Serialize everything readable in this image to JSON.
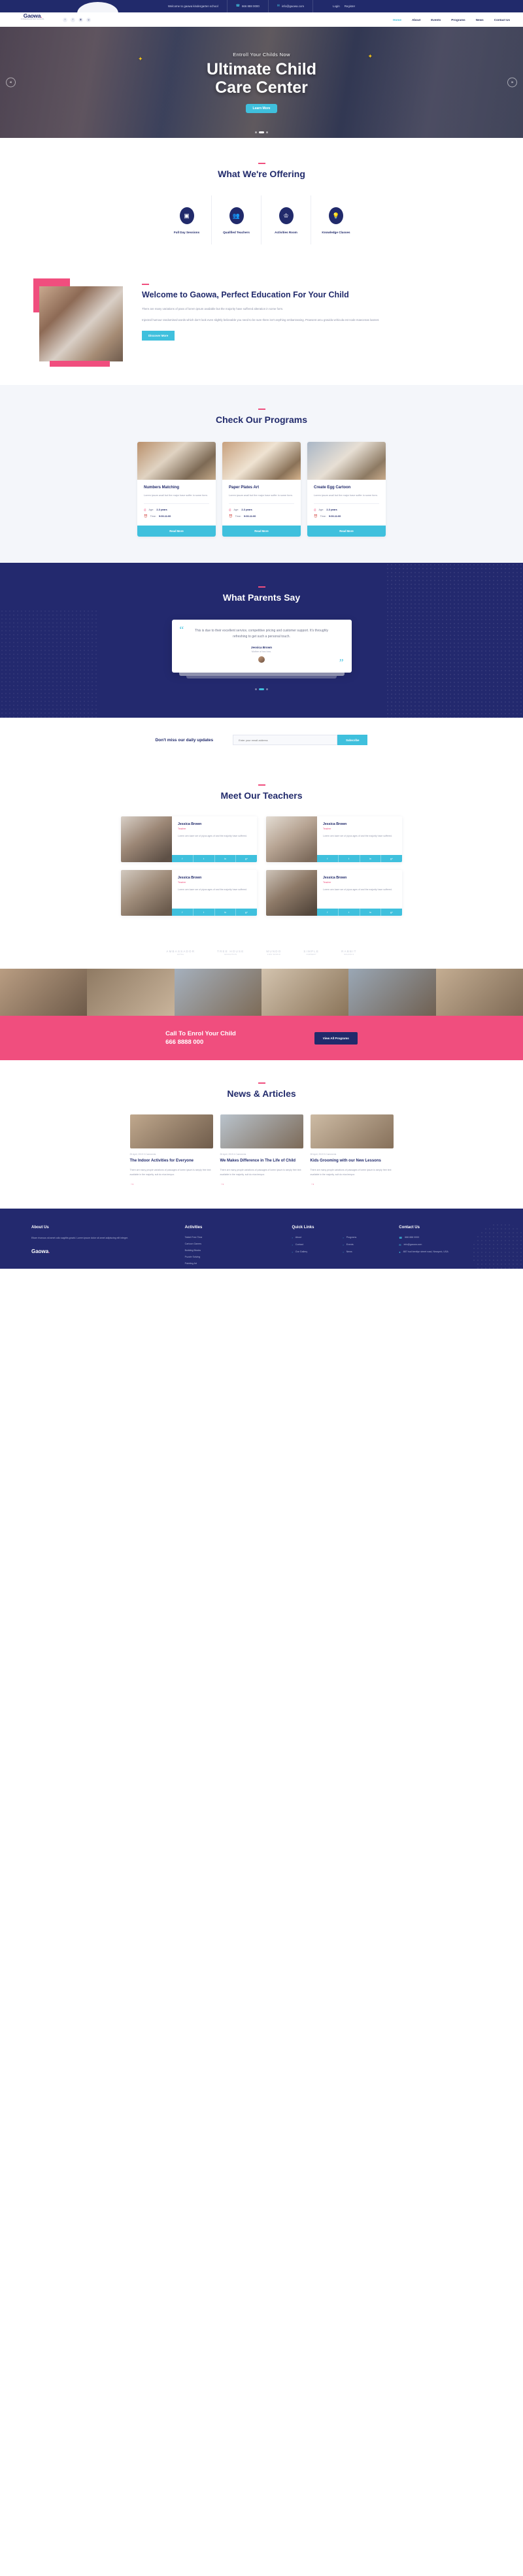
{
  "topbar": {
    "welcome": "Welcome to gaowa kindergarten school",
    "phone": "666 888 0000",
    "email": "info@gaowa.com",
    "login": "Login",
    "register": "Register",
    "phone_icon": "phone-icon",
    "mail_icon": "mail-icon"
  },
  "nav": {
    "logo": "Gaowa",
    "logo_sub": "KINDERGARTEN SCHOOL",
    "social": [
      "twitter-icon",
      "facebook-icon",
      "instagram-icon",
      "google-plus-icon"
    ],
    "menu": [
      {
        "label": "Home",
        "active": true
      },
      {
        "label": "About",
        "active": false
      },
      {
        "label": "Events",
        "active": false
      },
      {
        "label": "Programs",
        "active": false
      },
      {
        "label": "News",
        "active": false
      },
      {
        "label": "Contact Us",
        "active": false
      }
    ]
  },
  "hero": {
    "kicker": "Entroll Your Childs Now",
    "title_line1": "Ultimate Child",
    "title_line2": "Care Center",
    "button": "Learn More",
    "prev": "«",
    "next": "»"
  },
  "offering": {
    "title": "What We're Offering",
    "cards": [
      {
        "label": "Full Day Sessions",
        "icon": "abc-blocks-icon",
        "glyph": "🔠"
      },
      {
        "label": "Qualified Teachers",
        "icon": "teachers-icon",
        "glyph": "👥"
      },
      {
        "label": "Activities Room",
        "icon": "rocking-horse-icon",
        "glyph": "🐎"
      },
      {
        "label": "Knowledge Classes",
        "icon": "lightbulb-icon",
        "glyph": "💡"
      }
    ]
  },
  "welcome": {
    "title": "Welcome to Gaowa, Perfect Education For Your Child",
    "p1": "There are many variations of pass of lorem ipsum available but the majority have suffered alteration in some form.",
    "p2": "Injected humour randomised words which don't look even slightly believable you need to be sure there isn't anything embarrassing. Praesent arcu gravida vehicula est node maecenas loareet.",
    "button": "Discover More"
  },
  "programs": {
    "title": "Check Our Programs",
    "cards": [
      {
        "title": "Numbers Matching",
        "desc": "Lorem ipsum avail but the major have suffer in some form.",
        "age_label": "Age:",
        "age": "2-3 years",
        "time_label": "Time:",
        "time": "9:00-11:00",
        "button": "Read More"
      },
      {
        "title": "Paper Plates Art",
        "desc": "Lorem ipsum avail but the major have suffer in some form.",
        "age_label": "Age:",
        "age": "2-3 years",
        "time_label": "Time:",
        "time": "9:00-11:00",
        "button": "Read More"
      },
      {
        "title": "Create Egg Cartoon",
        "desc": "Lorem ipsum avail but the major have suffer in some form.",
        "age_label": "Age:",
        "age": "2-3 years",
        "time_label": "Time:",
        "time": "9:00-11:00",
        "button": "Read More"
      }
    ]
  },
  "testimonial": {
    "title": "What Parents Say",
    "quote": "This is due to their excellent service, competitive pricing and customer support. It's throughly refreshing to get such a personal touch.",
    "name": "Jessica Brown",
    "role": "Mother of two lovs."
  },
  "newsletter": {
    "title": "Don't miss our daily updates",
    "placeholder": "Enter your email address",
    "button": "Subscribe"
  },
  "teachers": {
    "title": "Meet Our Teachers",
    "cards": [
      {
        "name": "Jessica Brown",
        "role": "Teacher",
        "desc": "Lorem oen loare ser of piyus ages of and the majority have suffered.",
        "social": [
          "f",
          "t",
          "in",
          "g+"
        ]
      },
      {
        "name": "Jessica Brown",
        "role": "Teacher",
        "desc": "Lorem oen loare ser of piyus ages of and the majority have suffered.",
        "social": [
          "f",
          "t",
          "in",
          "g+"
        ]
      },
      {
        "name": "Jessica Brown",
        "role": "Teacher",
        "desc": "Lorem oen loare ser of piyus ages of and the majority have suffered.",
        "social": [
          "f",
          "t",
          "in",
          "g+"
        ]
      },
      {
        "name": "Jessica Brown",
        "role": "Teacher",
        "desc": "Lorem oen loare ser of piyus ages of and the majority have suffered.",
        "social": [
          "f",
          "t",
          "in",
          "g+"
        ]
      }
    ]
  },
  "brands": [
    {
      "name": "AMBASSADOR",
      "sub": "HOTEL"
    },
    {
      "name": "TREE HOUSE",
      "sub": "EDUCATION"
    },
    {
      "name": "MUNDO",
      "sub": "KIDS WORLD"
    },
    {
      "name": "SIMPLE",
      "sub": "NURSERY"
    },
    {
      "name": "RABBIT",
      "sub": "SCHOOLS"
    }
  ],
  "cta": {
    "line1": "Call To Enrol Your Child",
    "line2": "666 8888 000",
    "button": "View All Programs"
  },
  "newsblog": {
    "title": "News & Articles",
    "cards": [
      {
        "meta": "25 April, 2019    3 Comments",
        "title": "The Indoor Activities for Everyone",
        "desc": "There are many people variations of passages of lorem ipsum is simply free text available in the majority. suit do eius tempor.",
        "arrow": "arrow-right-icon"
      },
      {
        "meta": "26 April, 2019    4 Comments",
        "title": "We Makes Difference in The Life of Child",
        "desc": "There are many people variations of passages of lorem ipsum is simply free text available in the majority. suit do eius tempor.",
        "arrow": "arrow-right-icon"
      },
      {
        "meta": "28 April, 2019    5 Comments",
        "title": "Kids Grooming with our New Lessons",
        "desc": "There are many people variations of passages of lorem ipsum is simply free text available in the majority. suit do eius tempor.",
        "arrow": "arrow-right-icon"
      }
    ]
  },
  "footer": {
    "about_title": "About Us",
    "about_text": "Etiam rhoncus sit amet odio sagittis gravid. Lorem ipsum dolor sit amet adipiscing elit integre.",
    "logo": "Gaowa",
    "activities_title": "Activities",
    "activities": [
      "Tablet Free Time",
      "Cartoon Games",
      "Building Blocks",
      "Puzzle Solving",
      "Painting Art"
    ],
    "quick_title": "Quick Links",
    "quick": [
      "About",
      "Contact",
      "Our Gallery",
      "Programs",
      "Events",
      "News"
    ],
    "contact_title": "Contact Us",
    "contact": [
      {
        "icon": "phone-icon",
        "text": "666 888 0000"
      },
      {
        "icon": "mail-icon",
        "text": "info@gaowa.com"
      },
      {
        "icon": "location-icon",
        "text": "887 hud bentlyn street road, Newyork, USA"
      }
    ]
  },
  "colors": {
    "navy": "#23296e",
    "cyan": "#3fc0dd",
    "pink": "#f04e7e"
  }
}
